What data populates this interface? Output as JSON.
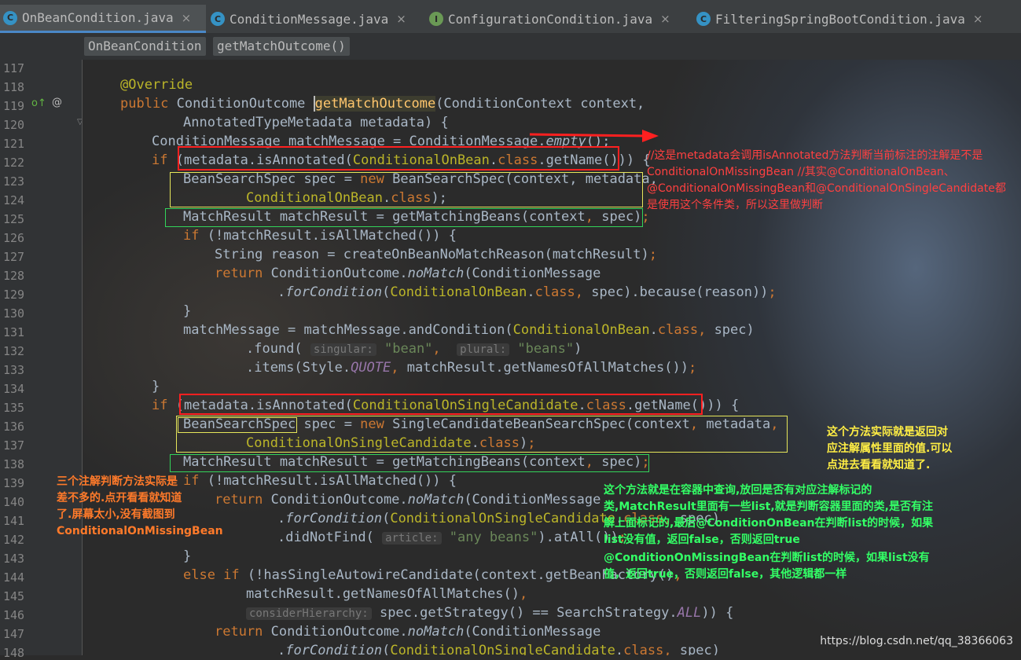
{
  "tabs": [
    {
      "label": "OnBeanCondition.java",
      "icon": "class-icon",
      "active": true
    },
    {
      "label": "ConditionMessage.java",
      "icon": "class-icon",
      "active": false
    },
    {
      "label": "ConfigurationCondition.java",
      "icon": "interface-icon",
      "active": false
    },
    {
      "label": "FilteringSpringBootCondition.java",
      "icon": "class-icon",
      "active": false
    }
  ],
  "tab_close": "×",
  "breadcrumbs": [
    "OnBeanCondition",
    "getMatchOutcome()"
  ],
  "line_numbers": [
    "117",
    "118",
    "119",
    "120",
    "121",
    "122",
    "123",
    "124",
    "125",
    "126",
    "127",
    "128",
    "129",
    "130",
    "131",
    "132",
    "133",
    "134",
    "135",
    "136",
    "137",
    "138",
    "139",
    "140",
    "141",
    "142",
    "143",
    "144",
    "145",
    "146",
    "147",
    "148"
  ],
  "gutter_icons": {
    "override": "o↑",
    "at": "@"
  },
  "hints": {
    "singular": "singular:",
    "plural": "plural:",
    "article": "article:",
    "consider": "considerHierarchy:"
  },
  "annotations": {
    "red_note": "//这是metadata会调用isAnnotated方法判断当前标注的注解是不是ConditionalOnMissingBean //其实@ConditionalOnBean、@ConditionalOnMissingBean和@ConditionalOnSingleCandidate都是使用这个条件类，所以这里做判断",
    "yellow_note": "这个方法实际就是返回对应注解属性里面的值.可以点进去看看就知道了.",
    "green_note_1": "这个方法就是在容器中查询,放回是否有对应注解标记的类,MatchResult里面有一些list,就是判断容器里面的类,是否有注解上面标记的,最后@ConditionOnBean在判断list的时候，如果list没有值，返回false，否则返回true",
    "green_note_2": "@ConditionOnMissingBean在判断list的时候，如果list没有值，返回true，否则返回false，其他逻辑都一样",
    "orange_note": "三个注解判断方法实际是差不多的.点开看看就知道了.屏幕太小,没有截图到ConditionalOnMissingBean"
  },
  "watermark": "https://blog.csdn.net/qq_38366063",
  "colors": {
    "keyword": "#cc7832",
    "annotation": "#bbb529",
    "string": "#6a8759",
    "text": "#a9b7c6",
    "box_red": "#ff2020",
    "box_yellow": "#e6e65a",
    "box_green": "#33d45a"
  }
}
